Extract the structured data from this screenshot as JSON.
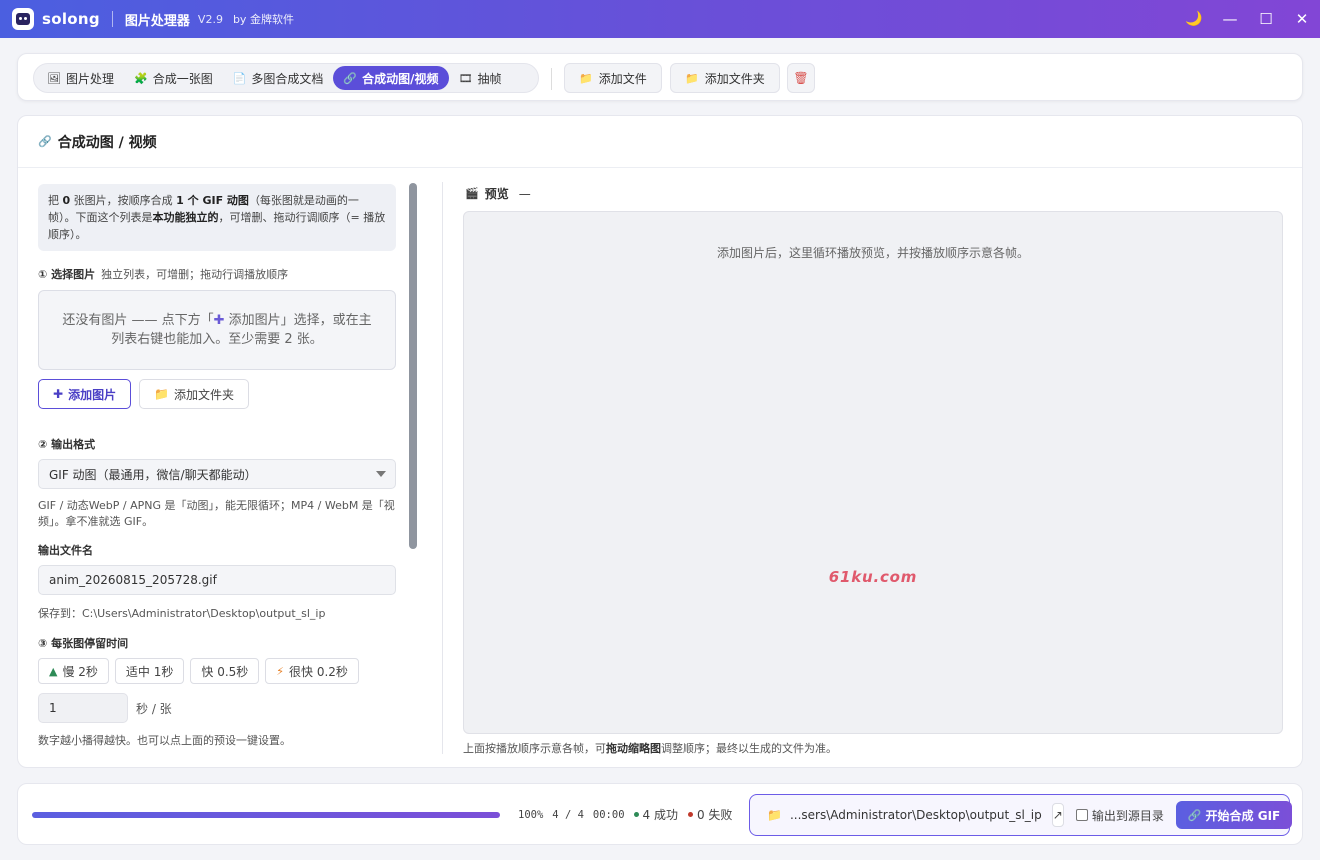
{
  "titlebar": {
    "brand": "solong",
    "app_title": "图片处理器",
    "version": "V2.9",
    "by": "by 金牌软件",
    "buttons": {
      "theme": "🌙",
      "minimize": "—",
      "maximize": "☐",
      "close": "✕"
    }
  },
  "toolbar": {
    "tabs": [
      {
        "icon": "🖼",
        "label": "图片处理"
      },
      {
        "icon": "🧩",
        "label": "合成一张图"
      },
      {
        "icon": "📄",
        "label": "多图合成文档"
      },
      {
        "icon": "🔗",
        "label": "合成动图/视频"
      },
      {
        "icon": "🎞",
        "label": "抽帧"
      }
    ],
    "active_tab": 3,
    "add_file": "添加文件",
    "add_folder": "添加文件夹",
    "folder_icon": "📁",
    "delete_icon": "🗑"
  },
  "panel": {
    "icon": "🔗",
    "title": "合成动图 / 视频",
    "info": {
      "p1": "把 ",
      "count": "0",
      "p2": " 张图片，按顺序合成 ",
      "fmt": "1 个 GIF 动图",
      "p3": "（每张图就是动画的一帧）。下面这个列表是",
      "indep": "本功能独立的",
      "p4": "，可增删、拖动行调顺序（= 播放顺序）。"
    },
    "step1": {
      "title": "① 选择图片",
      "sub": "独立列表，可增删；拖动行调播放顺序"
    },
    "dropzone": {
      "p1": "还没有图片 —— 点下方「",
      "p2": " 添加图片」选择，或在主列表右键也能加入。至少需要 2 张。"
    },
    "add_images": "添加图片",
    "add_folder": "添加文件夹",
    "step2": {
      "title": "② 输出格式"
    },
    "format_value": "GIF 动图（最通用，微信/聊天都能动）",
    "format_note": "GIF / 动态WebP / APNG 是「动图」，能无限循环；MP4 / WebM 是「视频」。拿不准就选 GIF。",
    "filename_label": "输出文件名",
    "filename_value": "anim_20260815_205728.gif",
    "save_to": "保存到：C:\\Users\\Administrator\\Desktop\\output_sl_ip",
    "step3": {
      "title": "③ 每张图停留时间"
    },
    "presets": [
      {
        "icon": "▲",
        "label": "慢 2秒",
        "color": "#2e8b57"
      },
      {
        "icon": "",
        "label": "适中 1秒",
        "color": ""
      },
      {
        "icon": "",
        "label": "快 0.5秒",
        "color": ""
      },
      {
        "icon": "⚡",
        "label": "很快 0.2秒",
        "color": "#e67e22"
      }
    ],
    "duration_value": "1",
    "duration_unit": "秒 / 张",
    "duration_note": "数字越小播得越快。也可以点上面的预设一键设置。"
  },
  "preview": {
    "icon": "🎬",
    "title": "预览",
    "dash": "—",
    "placeholder": "添加图片后，这里循环播放预览，并按播放顺序示意各帧。",
    "watermark": "61ku.com",
    "note_p1": "上面按播放顺序示意各帧，可",
    "note_bold": "拖动缩略图",
    "note_p2": "调整顺序；最终以生成的文件为准。"
  },
  "bottom": {
    "progress_percent": 100,
    "percent_text": "100%",
    "count_text": "4 / 4",
    "time_text": "00:00",
    "success_text": "4 成功",
    "fail_text": "0 失败",
    "success_color": "#2e8b57",
    "fail_color": "#c0392b",
    "folder_icon": "📁",
    "output_path": "...sers\\Administrator\\Desktop\\output_sl_ip",
    "open_icon": "↗",
    "to_source_label": "输出到源目录",
    "start_icon": "🔗",
    "start_label": "开始合成 GIF"
  }
}
